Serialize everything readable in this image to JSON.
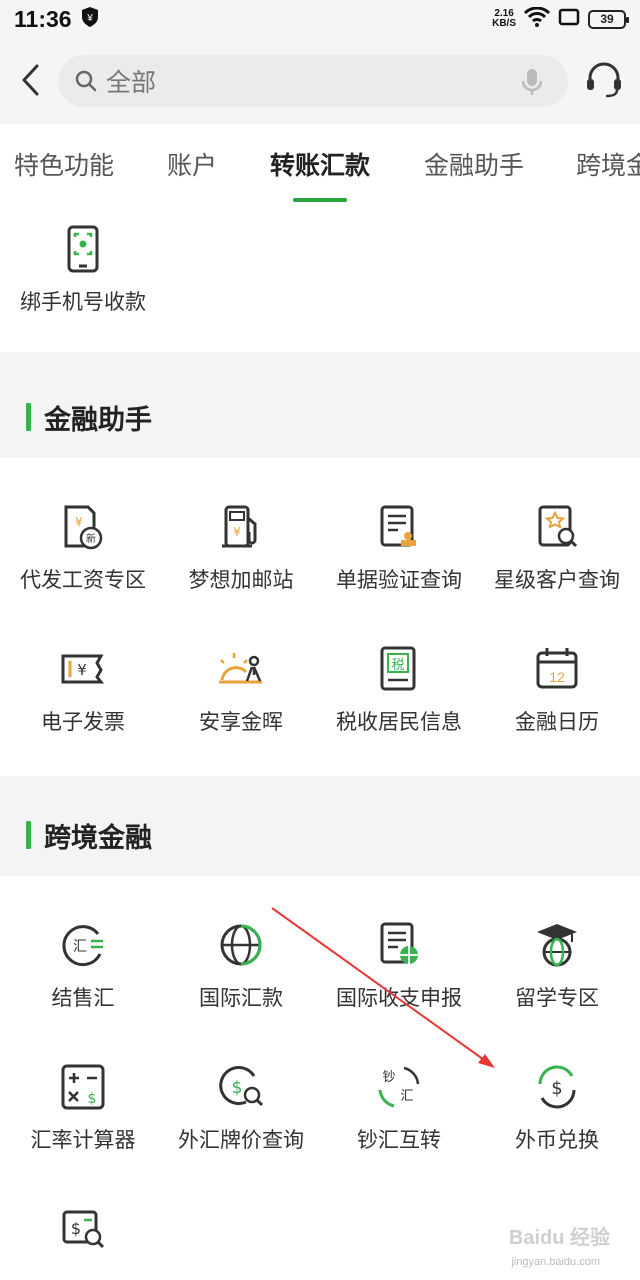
{
  "status": {
    "time": "11:36",
    "net_speed": "2.16",
    "net_unit": "KB/S",
    "battery": "39"
  },
  "search": {
    "placeholder": "全部"
  },
  "tabs": [
    "特色功能",
    "账户",
    "转账汇款",
    "金融助手",
    "跨境金"
  ],
  "active_tab": "转账汇款",
  "top_items": [
    {
      "label": "绑手机号收款",
      "icon": "phone-scan-icon"
    }
  ],
  "sections": [
    {
      "title": "金融助手",
      "items": [
        {
          "label": "代发工资专区",
          "icon": "payroll-icon"
        },
        {
          "label": "梦想加邮站",
          "icon": "fuel-station-icon"
        },
        {
          "label": "单据验证查询",
          "icon": "document-stamp-icon"
        },
        {
          "label": "星级客户查询",
          "icon": "star-search-icon"
        },
        {
          "label": "电子发票",
          "icon": "invoice-icon"
        },
        {
          "label": "安享金晖",
          "icon": "sunset-elder-icon"
        },
        {
          "label": "税收居民信息",
          "icon": "tax-book-icon"
        },
        {
          "label": "金融日历",
          "icon": "calendar-icon"
        }
      ]
    },
    {
      "title": "跨境金融",
      "items": [
        {
          "label": "结售汇",
          "icon": "exchange-settle-icon"
        },
        {
          "label": "国际汇款",
          "icon": "globe-icon"
        },
        {
          "label": "国际收支申报",
          "icon": "document-globe-icon"
        },
        {
          "label": "留学专区",
          "icon": "graduation-globe-icon"
        },
        {
          "label": "汇率计算器",
          "icon": "calculator-icon"
        },
        {
          "label": "外汇牌价查询",
          "icon": "dollar-search-icon"
        },
        {
          "label": "钞汇互转",
          "icon": "cash-exchange-icon"
        },
        {
          "label": "外币兑换",
          "icon": "currency-exchange-icon"
        }
      ]
    }
  ],
  "bottom_items": [
    {
      "label": "",
      "icon": "dollar-doc-search-icon"
    }
  ],
  "watermark": {
    "text": "Baidu 经验",
    "sub": "jingyan.baidu.com"
  },
  "colors": {
    "accent": "#2aa33a",
    "icon_dark": "#333333",
    "icon_orange": "#e8a33a",
    "icon_green": "#37b24d",
    "arrow": "#e53935"
  }
}
